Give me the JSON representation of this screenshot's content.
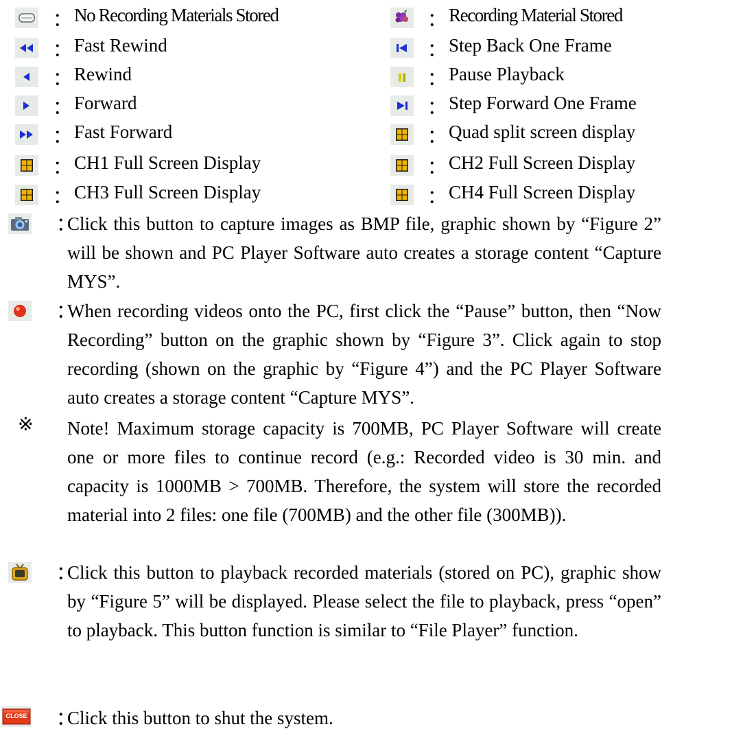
{
  "colon": "：",
  "legend_rows": [
    {
      "left": {
        "icon": "hard-disk-icon",
        "label": "No Recording Materials Stored"
      },
      "right": {
        "icon": "grape-icon",
        "label": "Recording Material Stored"
      }
    },
    {
      "left": {
        "icon": "fast-rewind-icon",
        "label": "Fast Rewind"
      },
      "right": {
        "icon": "step-back-icon",
        "label": "Step Back One Frame"
      }
    },
    {
      "left": {
        "icon": "rewind-icon",
        "label": "Rewind"
      },
      "right": {
        "icon": "pause-icon",
        "label": "Pause Playback"
      }
    },
    {
      "left": {
        "icon": "forward-icon",
        "label": "Forward"
      },
      "right": {
        "icon": "step-forward-icon",
        "label": "Step Forward One Frame"
      }
    },
    {
      "left": {
        "icon": "fast-forward-icon",
        "label": "Fast Forward"
      },
      "right": {
        "icon": "quad-split-icon",
        "label": "Quad split screen display"
      }
    },
    {
      "left": {
        "icon": "ch1-grid-icon",
        "label": "CH1 Full Screen Display"
      },
      "right": {
        "icon": "ch2-grid-icon",
        "label": "CH2 Full Screen Display"
      }
    },
    {
      "left": {
        "icon": "ch3-grid-icon",
        "label": "CH3 Full Screen Display"
      },
      "right": {
        "icon": "ch4-grid-icon",
        "label": "CH4 Full Screen Display"
      }
    }
  ],
  "capture": {
    "icon": "camera-icon",
    "text": "Click this button to capture images as BMP file, graphic shown by “Figure 2” will be shown and PC Player Software auto creates a storage content “Capture MYS”."
  },
  "record": {
    "icon": "record-icon",
    "text": "When recording videos onto the PC, first click the “Pause” button, then “Now Recording” button on the graphic shown by “Figure 3”. Click again to stop recording (shown on the graphic by “Figure 4”) and the PC Player Software auto creates a storage content “Capture MYS”."
  },
  "note": {
    "mark": "※",
    "text": "Note! Maximum storage capacity is 700MB, PC Player Software will create one or more files to continue record (e.g.: Recorded video is 30 min. and capacity is 1000MB > 700MB. Therefore, the system will store the recorded material into 2 files: one file (700MB) and the other file (300MB))."
  },
  "playback": {
    "icon": "tv-icon",
    "text": "Click this button to playback recorded materials (stored on PC), graphic show by “Figure 5” will be displayed. Please select the file to playback, press “open” to playback. This button function is similar to “File Player” function."
  },
  "close": {
    "icon": "close-button-icon",
    "icon_text": "CLOSE",
    "text": "Click this button to shut the system."
  },
  "colors": {
    "icon_bg": "#e7ebe7",
    "arrow_blue": "#1a2fd6",
    "grid_orange": "#f0b400",
    "record_red": "#e0301e"
  }
}
